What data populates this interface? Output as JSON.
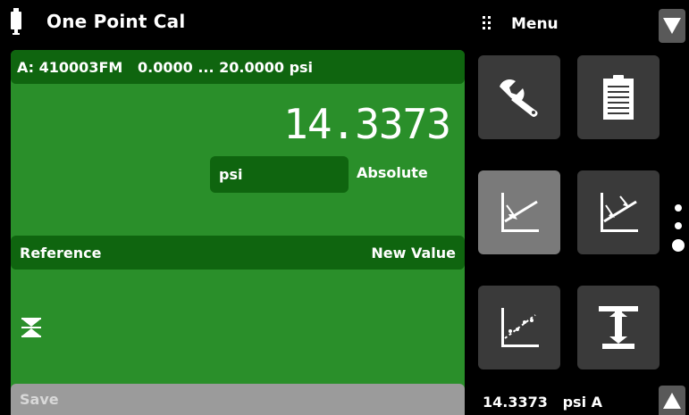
{
  "header": {
    "title": "One Point Cal",
    "battery_icon": "battery-icon"
  },
  "menu": {
    "label": "Menu",
    "icon": "grid-icon",
    "down_icon": "triangle-down-icon",
    "up_icon": "triangle-up-icon"
  },
  "panel": {
    "info": "A: 410003FM   0.0000 ... 20.0000 psi",
    "reading": "14.3373",
    "unit": "psi",
    "mode": "Absolute",
    "reference_label": "Reference",
    "new_value_label": "New Value",
    "zero_icon": "zero-hourglass-icon",
    "save_label": "Save"
  },
  "tiles": [
    {
      "name": "settings-wrench-tile",
      "icon": "wrench-icon"
    },
    {
      "name": "info-document-tile",
      "icon": "document-icon"
    },
    {
      "name": "one-point-cal-tile",
      "icon": "one-point-cal-icon"
    },
    {
      "name": "two-point-cal-tile",
      "icon": "two-point-cal-icon"
    },
    {
      "name": "linearization-tile",
      "icon": "linearization-icon"
    },
    {
      "name": "span-tile",
      "icon": "span-icon"
    }
  ],
  "status": {
    "value": "14.3373   psi A"
  },
  "colors": {
    "panel_green": "#2a8f2a",
    "dark_green": "#0f650f",
    "tile_gray": "#3a3a3a",
    "tile_active": "#7a7a7a",
    "save_gray": "#9b9b9b"
  }
}
